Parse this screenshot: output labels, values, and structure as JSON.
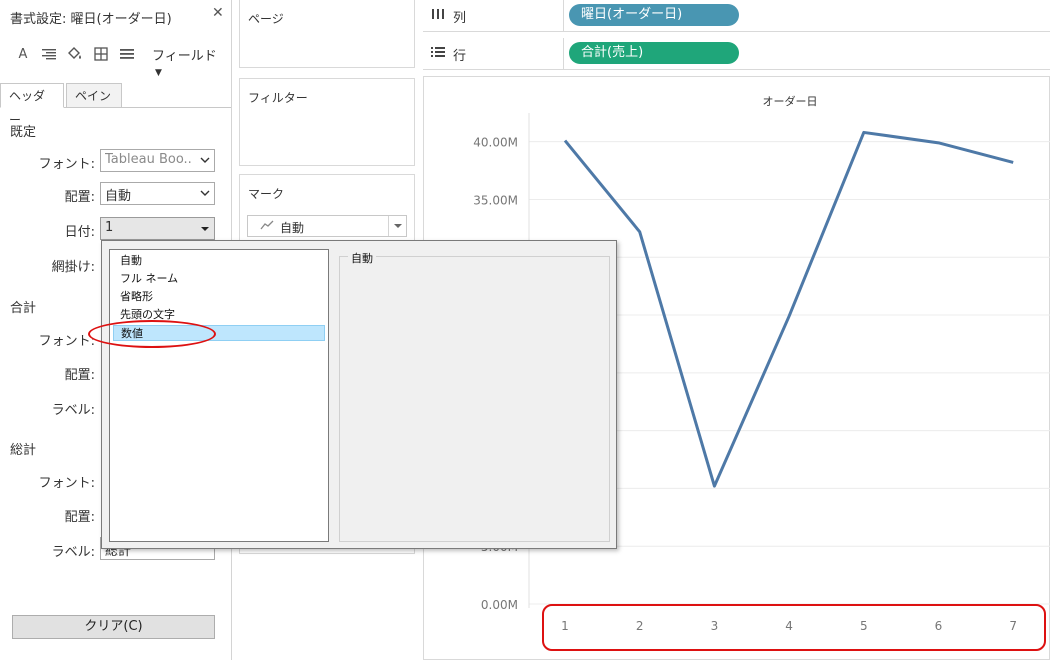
{
  "format_panel": {
    "title": "書式設定: 曜日(オーダー日)",
    "field_menu": "フィールド",
    "tabs": [
      "ヘッダー",
      "ペイン"
    ],
    "default_section": {
      "title": "既定",
      "font_label": "フォント:",
      "font_value": "Tableau Boo..",
      "alignment_label": "配置:",
      "alignment_value": "自動",
      "date_label": "日付:",
      "date_value": "1",
      "shading_label": "網掛け:"
    },
    "total_section": {
      "title": "合計",
      "font_label": "フォント:",
      "alignment_label": "配置:",
      "label_label": "ラベル:"
    },
    "grand_total_section": {
      "title": "総計",
      "font_label": "フォント:",
      "alignment_label": "配置:",
      "label_label": "ラベル:",
      "label_value": "総計"
    },
    "clear_button": "クリア(C)"
  },
  "date_popup": {
    "items": [
      "自動",
      "フル ネーム",
      "省略形",
      "先頭の文字",
      "数値"
    ],
    "selected_index": 4,
    "preview_label": "自動"
  },
  "shelves": {
    "pages_title": "ページ",
    "filters_title": "フィルター",
    "marks_title": "マーク",
    "marks_type": "自動",
    "columns_label": "列",
    "columns_pill": "曜日(オーダー日)",
    "rows_label": "行",
    "rows_pill": "合計(売上)"
  },
  "colors": {
    "columns_pill": "#4996b2",
    "rows_pill": "#1fa67a",
    "line": "#4e79a7",
    "highlight": "#dd1111"
  },
  "chart_data": {
    "type": "line",
    "title": "オーダー日",
    "x": [
      1,
      2,
      3,
      4,
      5,
      6,
      7
    ],
    "series": [
      {
        "values": [
          40100000,
          32200000,
          10200000,
          24900000,
          40800000,
          39900000,
          38200000
        ]
      }
    ],
    "yticks": [
      "0.00M",
      "5.00M",
      "35.00M",
      "40.00M"
    ],
    "ytick_values": [
      0,
      5000000,
      35000000,
      40000000
    ],
    "ylim": [
      0,
      43000000
    ],
    "grid": true
  }
}
